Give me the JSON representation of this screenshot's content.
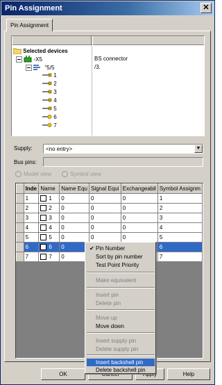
{
  "window": {
    "title": "Pin Assignment",
    "close_glyph": "✕"
  },
  "tab": {
    "label": "Pin Assignment"
  },
  "tree": {
    "root_label": "Selected devices",
    "device": {
      "name": "-X5",
      "description": "BS connector"
    },
    "subdevice": {
      "name": "\"5/5",
      "description": "/3."
    },
    "pins": [
      "1",
      "2",
      "3",
      "4",
      "5",
      "6",
      "7"
    ]
  },
  "supply": {
    "label": "Supply:",
    "value": "<no entry>"
  },
  "bus": {
    "label": "Bus pins:"
  },
  "views": {
    "model": "Model view",
    "symbol": "Symbol view"
  },
  "table": {
    "headers": [
      "Inde",
      "Name",
      "Name Equ",
      "Signal Equi",
      "Exchangeabil",
      "Symbol Assignm"
    ],
    "rows": [
      [
        "1",
        "1",
        "0",
        "0",
        "0",
        "1"
      ],
      [
        "2",
        "2",
        "0",
        "0",
        "0",
        "2"
      ],
      [
        "3",
        "3",
        "0",
        "0",
        "0",
        "3"
      ],
      [
        "4",
        "4",
        "0",
        "0",
        "0",
        "4"
      ],
      [
        "5",
        "5",
        "0",
        "0",
        "0",
        "5"
      ],
      [
        "6",
        "6",
        "0",
        "",
        "",
        "6"
      ],
      [
        "7",
        "7",
        "0",
        "",
        "",
        "7"
      ]
    ],
    "selected_row": 6
  },
  "context_menu": {
    "items": [
      {
        "label": "Pin Number",
        "checked": true,
        "disabled": false
      },
      {
        "label": "Sort by pin number",
        "disabled": false
      },
      {
        "label": "Test Point Priority",
        "disabled": false
      },
      {
        "label": "Make equivalent",
        "disabled": true
      },
      {
        "label": "Insert pin",
        "disabled": true
      },
      {
        "label": "Delete pin",
        "disabled": true
      },
      {
        "label": "Move up",
        "disabled": true
      },
      {
        "label": "Move down",
        "disabled": false
      },
      {
        "label": "Insert supply pin",
        "disabled": true
      },
      {
        "label": "Delete supply pin",
        "disabled": true
      },
      {
        "label": "Insert backshell pin",
        "disabled": false,
        "highlighted": true
      },
      {
        "label": "Delete backshell pin",
        "disabled": false
      }
    ]
  },
  "buttons": {
    "ok": "OK",
    "cancel": "Cancel",
    "apply": "Apply",
    "help": "Help"
  },
  "colors": {
    "selection": "#316ac5",
    "title_start": "#0a246a",
    "face": "#d4d0c8"
  }
}
